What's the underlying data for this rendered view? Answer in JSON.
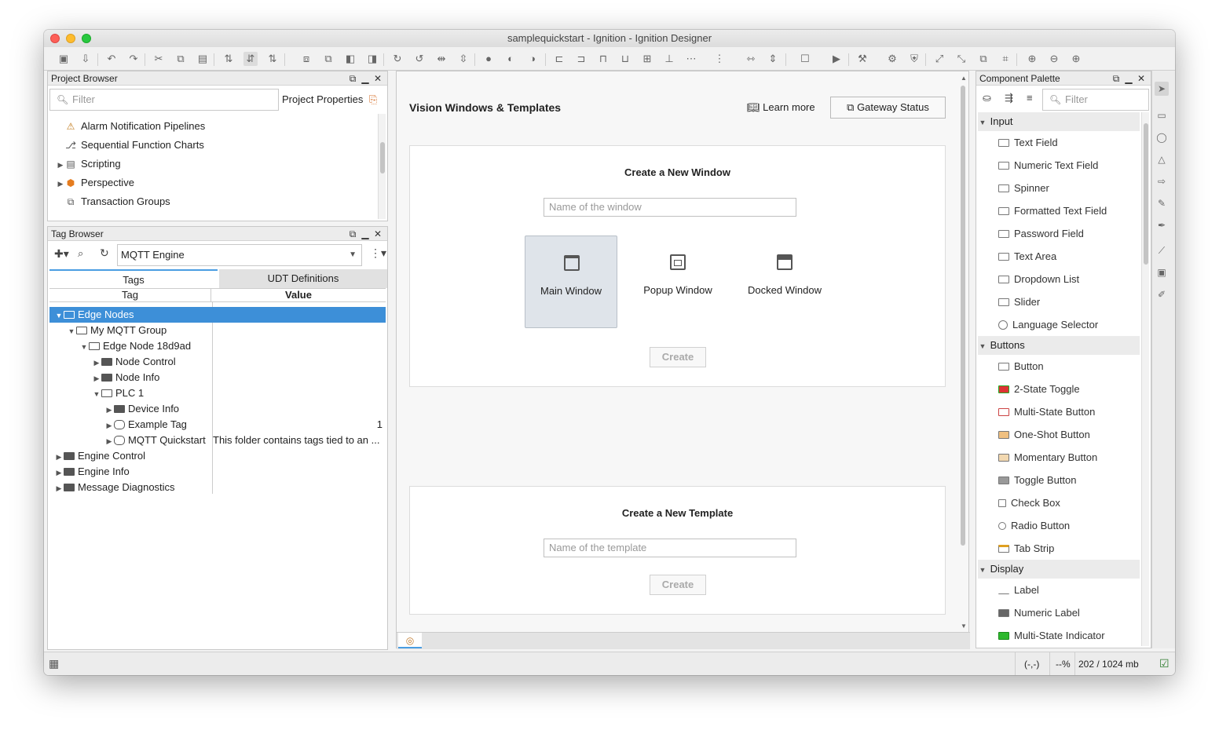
{
  "window": {
    "title": "samplequickstart - Ignition - Ignition Designer"
  },
  "project_browser": {
    "title": "Project Browser",
    "filter_placeholder": "Filter",
    "properties_label": "Project Properties",
    "items": [
      {
        "label": "Alarm Notification Pipelines",
        "icon": "alarm-pipeline-icon"
      },
      {
        "label": "Sequential Function Charts",
        "icon": "sfc-icon"
      },
      {
        "label": "Scripting",
        "icon": "scripting-icon"
      },
      {
        "label": "Perspective",
        "icon": "perspective-icon"
      },
      {
        "label": "Transaction Groups",
        "icon": "transaction-groups-icon"
      }
    ]
  },
  "tag_browser": {
    "title": "Tag Browser",
    "provider": "MQTT Engine",
    "tabs": [
      "Tags",
      "UDT Definitions"
    ],
    "columns": [
      "Tag",
      "Value"
    ],
    "rows": [
      {
        "label": "Edge Nodes",
        "value": ""
      },
      {
        "label": "My MQTT Group",
        "value": ""
      },
      {
        "label": "Edge Node 18d9ad",
        "value": ""
      },
      {
        "label": "Node Control",
        "value": ""
      },
      {
        "label": "Node Info",
        "value": ""
      },
      {
        "label": "PLC 1",
        "value": ""
      },
      {
        "label": "Device Info",
        "value": ""
      },
      {
        "label": "Example Tag",
        "value": "1"
      },
      {
        "label": "MQTT Quickstart",
        "value": "This folder contains tags tied to an ..."
      },
      {
        "label": "Engine Control",
        "value": ""
      },
      {
        "label": "Engine Info",
        "value": ""
      },
      {
        "label": "Message Diagnostics",
        "value": ""
      }
    ]
  },
  "center": {
    "heading": "Vision Windows & Templates",
    "learn_more": "Learn more",
    "gateway_status": "Gateway Status",
    "new_window": {
      "title": "Create a New Window",
      "placeholder": "Name of the window",
      "types": [
        "Main Window",
        "Popup Window",
        "Docked Window"
      ],
      "create": "Create"
    },
    "new_template": {
      "title": "Create a New Template",
      "placeholder": "Name of the template",
      "create": "Create"
    }
  },
  "palette": {
    "title": "Component Palette",
    "filter_placeholder": "Filter",
    "categories": [
      {
        "name": "Input",
        "items": [
          "Text Field",
          "Numeric Text Field",
          "Spinner",
          "Formatted Text Field",
          "Password Field",
          "Text Area",
          "Dropdown List",
          "Slider",
          "Language Selector"
        ]
      },
      {
        "name": "Buttons",
        "items": [
          "Button",
          "2-State Toggle",
          "Multi-State Button",
          "One-Shot Button",
          "Momentary Button",
          "Toggle Button",
          "Check Box",
          "Radio Button",
          "Tab Strip"
        ]
      },
      {
        "name": "Display",
        "items": [
          "Label",
          "Numeric Label",
          "Multi-State Indicator"
        ]
      }
    ]
  },
  "status": {
    "coords": "(-,-)",
    "zoom": "--%",
    "memory": "202 / 1024 mb"
  },
  "colors": {
    "selection": "#3d8fd8",
    "tab_active": "#cfe3f5"
  }
}
